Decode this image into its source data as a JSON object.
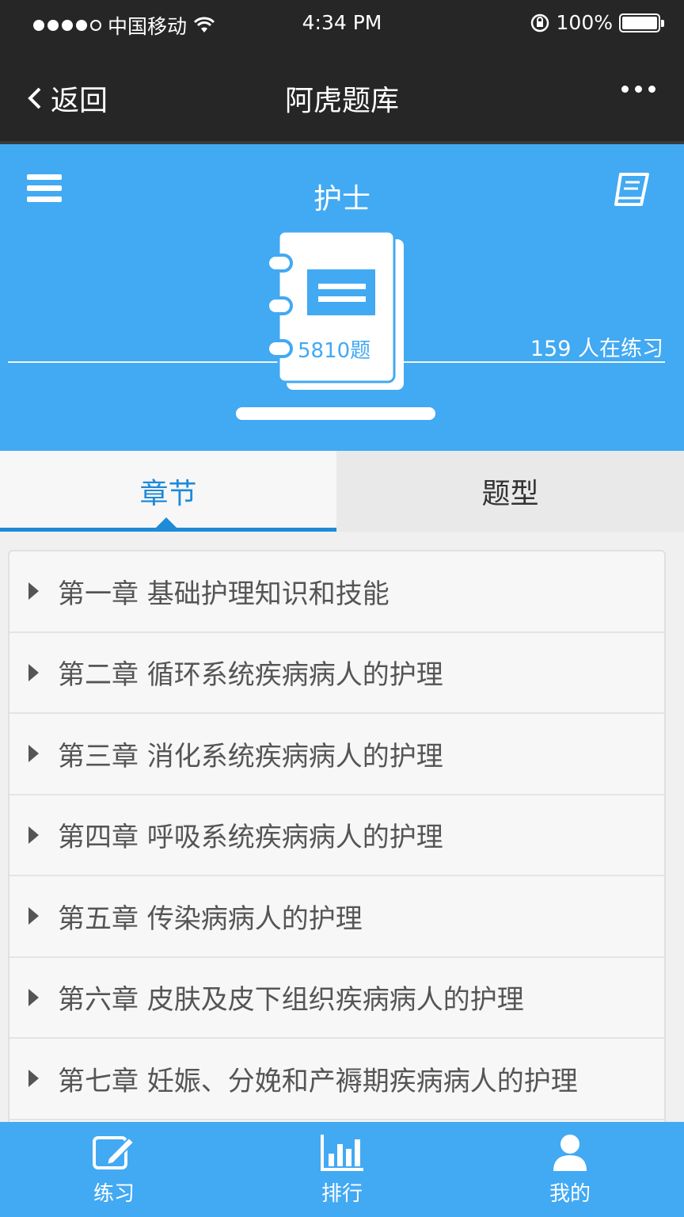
{
  "status_bar": {
    "carrier": "中国移动",
    "time": "4:34 PM",
    "battery": "100%"
  },
  "nav": {
    "back_label": "返回",
    "title": "阿虎题库"
  },
  "header": {
    "title": "护士",
    "question_count": "5810题",
    "practicing": "159 人在练习",
    "progress": 1.0
  },
  "tabs": [
    {
      "label": "章节",
      "active": true
    },
    {
      "label": "题型",
      "active": false
    }
  ],
  "chapters": [
    {
      "label": "第一章 基础护理知识和技能"
    },
    {
      "label": "第二章 循环系统疾病病人的护理"
    },
    {
      "label": "第三章 消化系统疾病病人的护理"
    },
    {
      "label": "第四章 呼吸系统疾病病人的护理"
    },
    {
      "label": "第五章 传染病病人的护理"
    },
    {
      "label": "第六章 皮肤及皮下组织疾病病人的护理"
    },
    {
      "label": "第七章 妊娠、分娩和产褥期疾病病人的护理"
    }
  ],
  "bottom_tabs": [
    {
      "label": "练习",
      "icon": "edit-icon"
    },
    {
      "label": "排行",
      "icon": "bar-chart-icon"
    },
    {
      "label": "我的",
      "icon": "user-icon"
    }
  ],
  "colors": {
    "primary": "#42a9f3",
    "accent": "#1e8ad8",
    "dark": "#262626"
  }
}
